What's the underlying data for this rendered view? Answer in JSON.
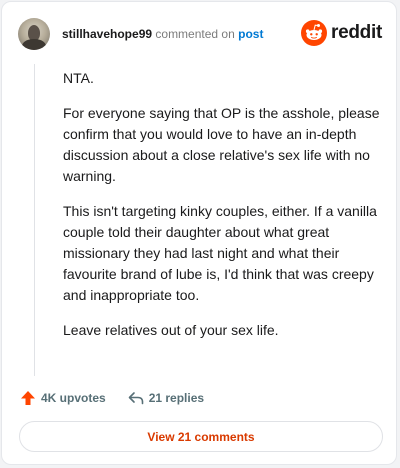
{
  "header": {
    "username": "stillhavehope99",
    "commented_text": "commented on",
    "post_link": "post",
    "brand": "reddit",
    "brand_color": "#ff4500"
  },
  "comment": {
    "paragraphs": [
      "NTA.",
      "For everyone saying that OP is the asshole, please confirm that you would love to have an in-depth discussion about a close relative's sex life with no warning.",
      "This isn't targeting kinky couples, either. If a vanilla couple told their daughter about what great missionary they had last night and what their favourite brand of lube is, I'd think that was creepy and inappropriate too.",
      "Leave relatives out of your sex life."
    ]
  },
  "actions": {
    "upvotes_label": "4K upvotes",
    "upvote_icon": "upvote-arrow-icon",
    "replies_label": "21 replies",
    "reply_icon": "reply-arrow-icon",
    "upvote_color": "#ff4500"
  },
  "footer": {
    "view_comments_label": "View 21 comments",
    "accent_color": "#d93a00"
  }
}
